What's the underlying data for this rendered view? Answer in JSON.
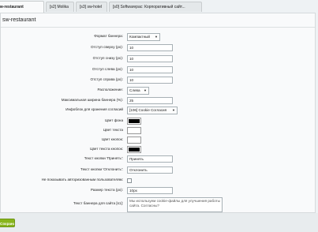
{
  "tabs": [
    {
      "label": "sw-restaurant"
    },
    {
      "label": "[s2] Molika"
    },
    {
      "label": "[s3] sw-hotel"
    },
    {
      "label": "[s0] Softwarepaс: Корпоративный сайт..."
    }
  ],
  "panel": {
    "title": "sw-restaurant"
  },
  "form": {
    "banner_format": {
      "label": "Формат баннера:",
      "value": "Компактный"
    },
    "margin_top": {
      "label": "Отступ сверху (px):",
      "value": "10"
    },
    "margin_bottom": {
      "label": "Отступ снизу (px):",
      "value": "10"
    },
    "margin_left": {
      "label": "Отступ слева (px):",
      "value": "10"
    },
    "margin_right": {
      "label": "Отступ справа (px):",
      "value": "10"
    },
    "position": {
      "label": "Расположение:",
      "value": "Слева"
    },
    "max_width": {
      "label": "Максимальная ширина баннера (%):",
      "value": "25"
    },
    "iblock": {
      "label": "Инфоблок для хранения согласий",
      "value": "[106] Cookie Согласия"
    },
    "bg_color": {
      "label": "Цвет фона",
      "color": "#000000"
    },
    "text_color": {
      "label": "Цвет текста",
      "color": "#ffffff"
    },
    "btn_color": {
      "label": "Цвет кнопок:",
      "color": "#ffffff"
    },
    "btn_text_color": {
      "label": "Цвет текста кнопок:",
      "color": "#000000"
    },
    "accept_text": {
      "label": "Текст кнопки 'Принять':",
      "value": "Принять"
    },
    "decline_text": {
      "label": "Текст кнопки 'Отклонить':",
      "value": "Отклонить"
    },
    "hide_auth": {
      "label": "Не показывать авторизованным пользователям:",
      "checked": false
    },
    "font_size": {
      "label": "Размер текста (px):",
      "value": "10px"
    },
    "banner_text": {
      "label": "Текст баннера для сайта [s1]:",
      "value": "Мы используем cookie-файлы для улучшения работы сайта. Согласны?"
    }
  },
  "footer": {
    "save_label": "Сохранить"
  }
}
